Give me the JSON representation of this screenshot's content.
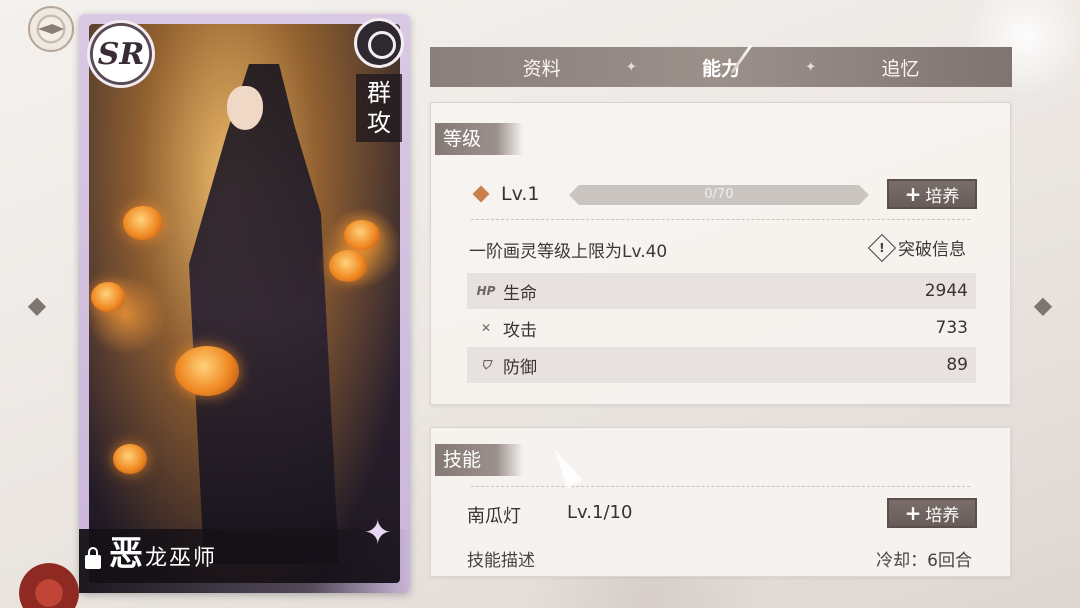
{
  "card": {
    "rarity": "SR",
    "role_tag": "群攻",
    "name_main": "恶",
    "name_rest": "龙巫师"
  },
  "tabs": [
    {
      "label": "资料",
      "active": false
    },
    {
      "label": "能力",
      "active": true
    },
    {
      "label": "追忆",
      "active": false
    }
  ],
  "level": {
    "section_title": "等级",
    "level_label": "Lv.1",
    "exp_text": "0/70",
    "exp_progress": 0.0,
    "train_label": "培养",
    "limit_text": "一阶画灵等级上限为Lv.40",
    "break_info_label": "突破信息",
    "stats": [
      {
        "icon": "hp-icon",
        "icon_text": "HP",
        "name": "生命",
        "value": "2944"
      },
      {
        "icon": "attack-icon",
        "icon_text": "✕",
        "name": "攻击",
        "value": "733"
      },
      {
        "icon": "shield-icon",
        "icon_text": "⛉",
        "name": "防御",
        "value": "89"
      }
    ]
  },
  "skill": {
    "section_title": "技能",
    "skill_name": "南瓜灯",
    "skill_level": "Lv.1/10",
    "train_label": "培养",
    "desc_label": "技能描述",
    "cooldown": "冷却：6回合"
  },
  "colors": {
    "tab_bg": "#8b7f7b",
    "panel_bg": "#f6f3f0",
    "accent_diamond": "#c9804b",
    "card_frame": "#d9c9e4"
  }
}
